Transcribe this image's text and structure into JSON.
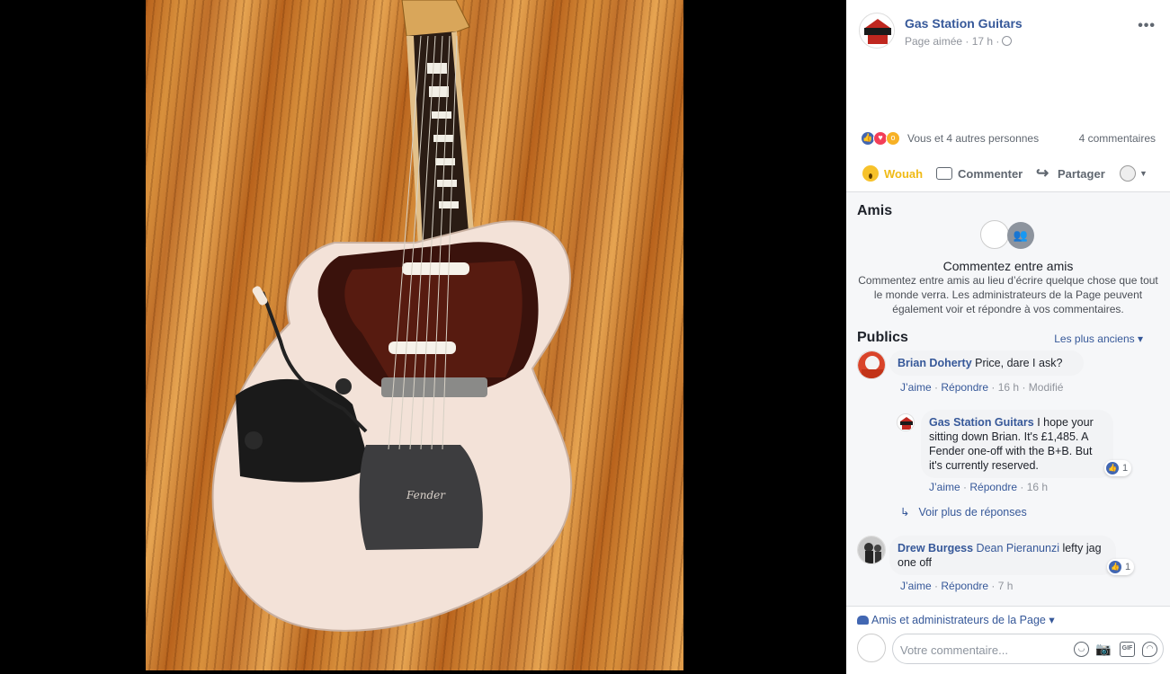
{
  "post": {
    "page_name": "Gas Station Guitars",
    "meta": "Page aimée · 17 h ·",
    "avatar_text": "GAS STATION"
  },
  "reactions": {
    "summary": "Vous et 4 autres personnes",
    "comments_count": "4 commentaires"
  },
  "actions": {
    "wow": "Wouah",
    "comment": "Commenter",
    "share": "Partager"
  },
  "friends_section": {
    "title": "Amis",
    "heading": "Commentez entre amis",
    "description": "Commentez entre amis au lieu d’écrire quelque chose que tout le monde verra. Les administrateurs de la Page peuvent également voir et répondre à vos commentaires."
  },
  "public_section": {
    "title": "Publics",
    "sort_label": "Les plus anciens"
  },
  "comments": [
    {
      "author": "Brian Doherty",
      "text": "Price, dare I ask?",
      "like": "J’aime",
      "reply": "Répondre",
      "time": "16 h",
      "edited": "Modifié"
    },
    {
      "author": "Gas Station Guitars",
      "text": "I hope your sitting down Brian. It's £1,485. A Fender one-off with the B+B. But it's currently reserved.",
      "like": "J’aime",
      "reply": "Répondre",
      "time": "16 h",
      "reactions": "1"
    },
    {
      "author": "Drew Burgess",
      "mention": "Dean Pieranunzi",
      "text": "lefty jag one off",
      "like": "J’aime",
      "reply": "Répondre",
      "time": "7 h",
      "reactions": "1"
    }
  ],
  "see_more_replies": "Voir plus de réponses",
  "footer": {
    "audience": "Amis et administrateurs de la Page",
    "composer_placeholder": "Votre commentaire..."
  },
  "colors": {
    "link": "#365899",
    "wow": "#f0ba15",
    "like": "#4267b2"
  }
}
